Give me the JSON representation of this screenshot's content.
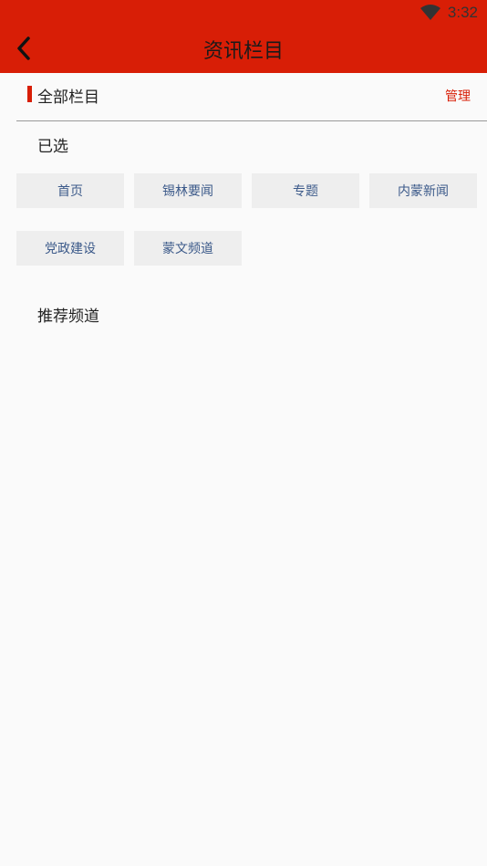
{
  "status_bar": {
    "time": "3:32",
    "icon": "wifi-icon"
  },
  "header": {
    "title": "资讯栏目",
    "back_icon": "back-arrow-icon",
    "background": "#d81e06"
  },
  "section": {
    "title": "全部栏目",
    "manage_label": "管理"
  },
  "selected": {
    "label": "已选",
    "channels": [
      "首页",
      "锡林要闻",
      "专题",
      "内蒙新闻",
      "党政建设",
      "蒙文频道"
    ]
  },
  "recommended": {
    "label": "推荐频道"
  },
  "colors": {
    "accent": "#d81e06",
    "chip_bg": "#eeeeee",
    "chip_text": "#3c5a8a"
  }
}
